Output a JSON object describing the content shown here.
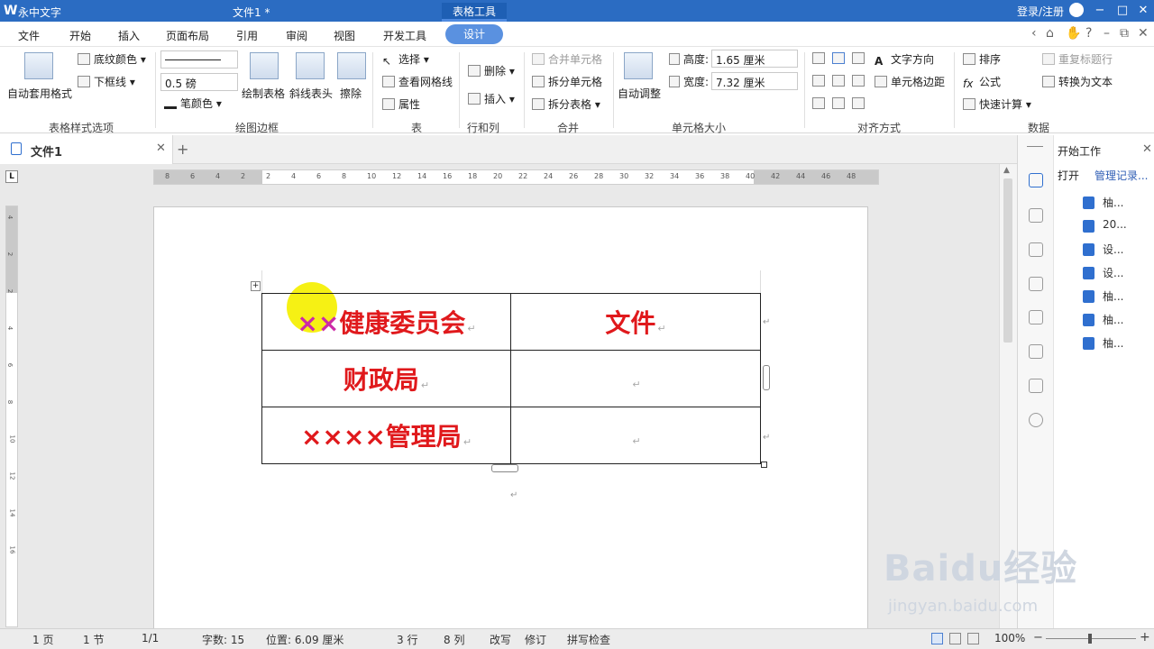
{
  "titlebar": {
    "app_name": "永中文字",
    "doc_title": "文件1 *",
    "context_tab": "表格工具",
    "login": "登录/注册"
  },
  "menu": [
    "文件",
    "开始",
    "插入",
    "页面布局",
    "引用",
    "审阅",
    "视图",
    "开发工具",
    "设计"
  ],
  "ribbon": {
    "styles": {
      "auto_format": "自动套用格式",
      "shading": "底纹颜色",
      "bottom_border": "下框线",
      "group": "表格样式选项"
    },
    "draw": {
      "pen_weight": "0.5 磅",
      "pen_color": "笔颜色",
      "draw_table": "绘制表格",
      "diagonal_header": "斜线表头",
      "eraser": "擦除",
      "group": "绘图边框"
    },
    "table": {
      "select": "选择",
      "gridlines": "查看网格线",
      "properties": "属性",
      "group": "表"
    },
    "rowscols": {
      "delete": "删除",
      "insert": "插入",
      "group": "行和列"
    },
    "merge": {
      "merge_cells": "合并单元格",
      "split_cells": "拆分单元格",
      "split_table": "拆分表格",
      "group": "合并"
    },
    "cellsize": {
      "auto_fit": "自动调整",
      "height_label": "高度:",
      "height_value": "1.65 厘米",
      "width_label": "宽度:",
      "width_value": "7.32 厘米",
      "group": "单元格大小"
    },
    "align": {
      "text_direction": "文字方向",
      "cell_margins": "单元格边距",
      "group": "对齐方式"
    },
    "data": {
      "sort": "排序",
      "formula": "公式",
      "quick_calc": "快速计算",
      "repeat_header": "重复标题行",
      "to_text": "转换为文本",
      "group": "数据"
    }
  },
  "doc_tab": {
    "label": "文件1",
    "add": "+"
  },
  "ruler": {
    "h_ticks": [
      "8",
      "6",
      "4",
      "2",
      "2",
      "4",
      "6",
      "8",
      "10",
      "12",
      "14",
      "16",
      "18",
      "20",
      "22",
      "24",
      "26",
      "28",
      "30",
      "32",
      "34",
      "36",
      "38",
      "40",
      "42",
      "44",
      "46",
      "48"
    ],
    "v_ticks": [
      "4",
      "2",
      "2",
      "4",
      "6",
      "8",
      "10",
      "12",
      "14",
      "16"
    ]
  },
  "table": {
    "rows": [
      [
        "××健康委员会",
        "文件"
      ],
      [
        "财政局",
        ""
      ],
      [
        "××××管理局",
        ""
      ]
    ],
    "row1_prefix": "××",
    "row1_rest": "健康委员会"
  },
  "panel": {
    "title": "开始工作",
    "open": "打开",
    "manage": "管理记录...",
    "files": [
      "柚...",
      "20...",
      "设...",
      "设...",
      "柚...",
      "柚...",
      "柚..."
    ]
  },
  "status": {
    "page": "1 页",
    "section": "1 节",
    "pages": "1/1",
    "words": "字数: 15",
    "position": "位置: 6.09 厘米",
    "row": "3 行",
    "col": "8 列",
    "overtype": "改写",
    "track": "修订",
    "spell": "拼写检查",
    "zoom": "100%"
  },
  "watermark": {
    "main": "Baidu经验",
    "sub": "jingyan.baidu.com"
  },
  "colors": {
    "title_bar": "#2b6cc2",
    "active_menu": "#5a91e0",
    "table_text": "#e0191c",
    "highlight": "#f5f000"
  }
}
